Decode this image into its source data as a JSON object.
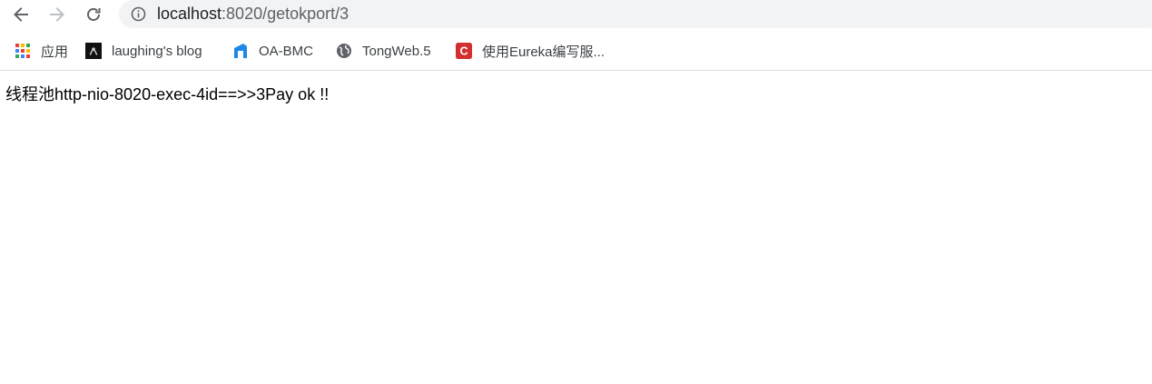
{
  "address_bar": {
    "host": "localhost",
    "path": ":8020/getokport/3"
  },
  "bookmarks": [
    {
      "label": "应用",
      "icon": "apps-grid-icon"
    },
    {
      "label": "laughing's blog",
      "icon": "blog-favicon-icon"
    },
    {
      "label": "OA-BMC",
      "icon": "oa-bmc-favicon-icon"
    },
    {
      "label": "TongWeb.5",
      "icon": "globe-icon"
    },
    {
      "label": "使用Eureka编写服...",
      "icon": "csdn-c-icon"
    }
  ],
  "page": {
    "message": "线程池http-nio-8020-exec-4id==>>3Pay ok !!"
  },
  "colors": {
    "omnibox_bg": "#f1f3f4",
    "csdn_red": "#d32f2f",
    "oa_blue": "#1e88e5"
  }
}
